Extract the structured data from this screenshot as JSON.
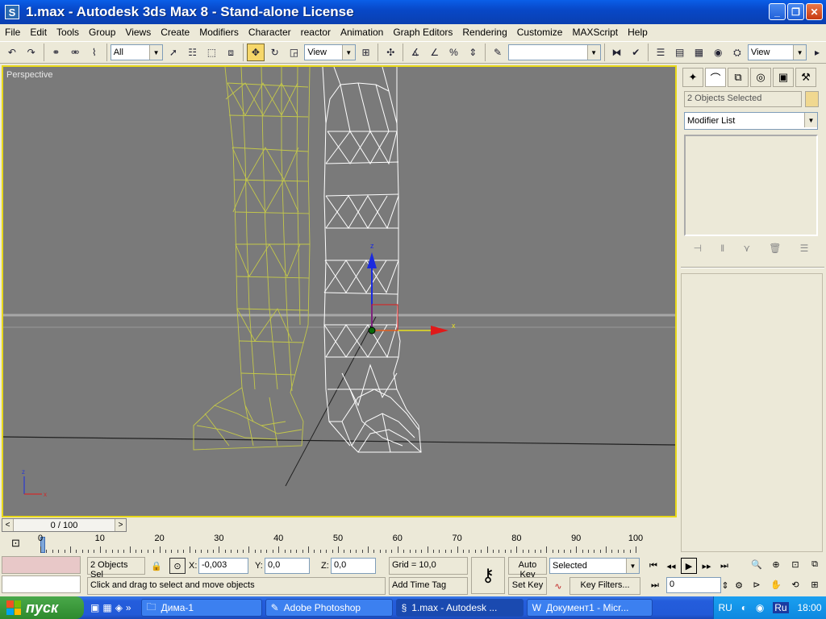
{
  "window": {
    "title": "1.max - Autodesk 3ds Max 8  - Stand-alone License",
    "app_icon": "S"
  },
  "menu": [
    "File",
    "Edit",
    "Tools",
    "Group",
    "Views",
    "Create",
    "Modifiers",
    "Character",
    "reactor",
    "Animation",
    "Graph Editors",
    "Rendering",
    "Customize",
    "MAXScript",
    "Help"
  ],
  "toolbar": {
    "selection_filter": "All",
    "ref_coord_1": "View",
    "named_selection": "",
    "ref_coord_2": "View"
  },
  "viewport": {
    "label": "Perspective",
    "gizmo_x": "x",
    "gizmo_z": "z",
    "triad_x": "x",
    "triad_z": "z"
  },
  "command_panel": {
    "selection_name": "2 Objects Selected",
    "modifier_list": "Modifier List",
    "selection_color": "#f0d890"
  },
  "time_slider": {
    "label": "0 / 100",
    "prev": "<",
    "next": ">"
  },
  "trackbar": {
    "ticks": [
      "0",
      "10",
      "20",
      "30",
      "40",
      "50",
      "60",
      "70",
      "80",
      "90",
      "100"
    ]
  },
  "status": {
    "selection_count": "2 Objects Sel",
    "prompt": "Click and drag to select and move objects",
    "x_label": "X:",
    "x_value": "-0,003",
    "y_label": "Y:",
    "y_value": "0,0",
    "z_label": "Z:",
    "z_value": "0,0",
    "grid": "Grid = 10,0",
    "add_time_tag": "Add Time Tag",
    "auto_key": "Auto Key",
    "set_key": "Set Key",
    "key_mode": "Selected",
    "key_filters": "Key Filters...",
    "current_frame": "0"
  },
  "taskbar": {
    "start": "пуск",
    "quicklaunch_more": "»",
    "tasks": [
      {
        "label": "Дима-1",
        "icon": "folder-icon"
      },
      {
        "label": "Adobe Photoshop",
        "icon": "photoshop-icon"
      },
      {
        "label": "1.max - Autodesk ...",
        "icon": "max-icon"
      },
      {
        "label": "Документ1 - Micr...",
        "icon": "word-icon"
      }
    ],
    "lang": "RU",
    "lang_badge": "Ru",
    "clock": "18:00"
  }
}
